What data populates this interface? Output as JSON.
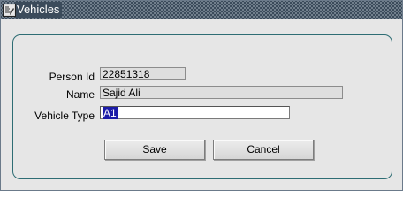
{
  "window": {
    "title": "Vehicles"
  },
  "form": {
    "person_id_label": "Person Id",
    "person_id_value": "22851318",
    "name_label": "Name",
    "name_value": "Sajid Ali",
    "vehicle_type_label": "Vehicle Type",
    "vehicle_type_value": "A1"
  },
  "buttons": {
    "save": "Save",
    "cancel": "Cancel"
  },
  "colors": {
    "titlebar": "#3b4b5b",
    "panel_border": "#2e6d74",
    "selection": "#1c1ca8",
    "background": "#e6e6e6"
  },
  "icons": {
    "title_icon": "app-icon"
  }
}
